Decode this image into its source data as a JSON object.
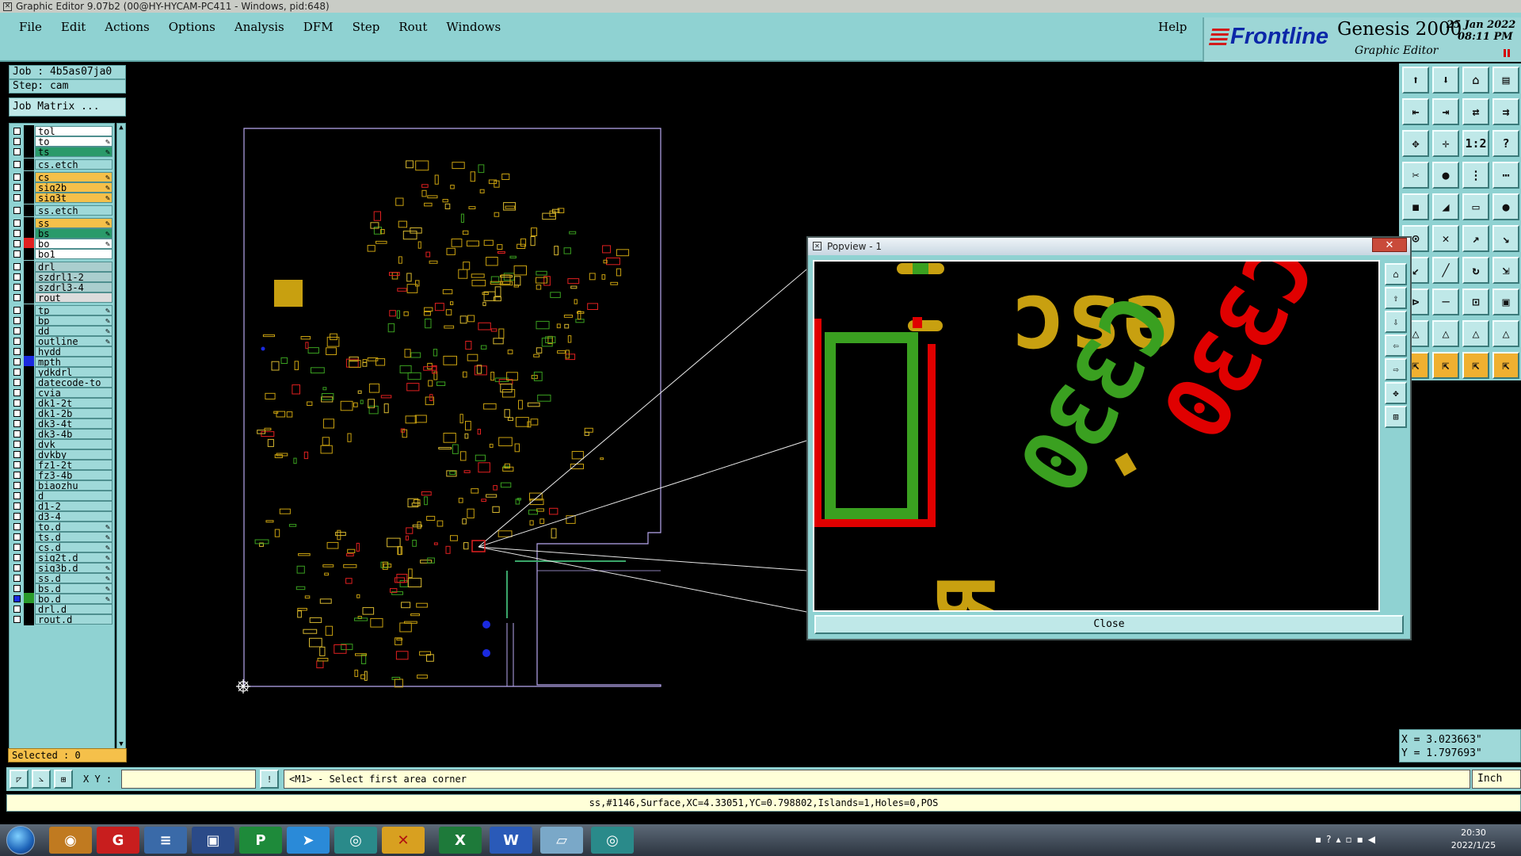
{
  "window": {
    "title": "Graphic Editor 9.07b2 (00@HY-HYCAM-PC411 - Windows, pid:648)"
  },
  "menu": {
    "items": [
      "File",
      "Edit",
      "Actions",
      "Options",
      "Analysis",
      "DFM",
      "Step",
      "Rout",
      "Windows"
    ],
    "help": "Help"
  },
  "brand": {
    "logo": "Frontline",
    "product": "Genesis 2000",
    "subtitle": "Graphic Editor",
    "date": "25 Jan 2022",
    "time": "08:11 PM"
  },
  "job": {
    "job": "Job : 4b5as07ja0",
    "step": "Step: cam",
    "matrix": "Job Matrix ..."
  },
  "layers": [
    {
      "name": "tol",
      "bg": "#ffffff"
    },
    {
      "name": "to",
      "bg": "#ffffff",
      "edit": true
    },
    {
      "name": "ts",
      "bg": "#2a9a6a",
      "edit": true
    },
    {
      "name": "cs.etch",
      "bg": "#9fd9d9",
      "gap": true
    },
    {
      "name": "cs",
      "bg": "#f5c04a",
      "edit": true,
      "gap": true
    },
    {
      "name": "sig2b",
      "bg": "#f5c04a",
      "edit": true
    },
    {
      "name": "sig3t",
      "bg": "#f5c04a",
      "edit": true
    },
    {
      "name": "ss.etch",
      "bg": "#9fd9d9",
      "gap": true
    },
    {
      "name": "ss",
      "bg": "#f5c04a",
      "edit": true,
      "gap": true
    },
    {
      "name": "bs",
      "bg": "#2a9a6a",
      "edit": true
    },
    {
      "name": "bo",
      "bg": "#ffffff",
      "edit": true,
      "color": "#e02020"
    },
    {
      "name": "bo1",
      "bg": "#ffffff"
    },
    {
      "name": "drl",
      "bg": "#aacece",
      "gap": true
    },
    {
      "name": "szdrl1-2",
      "bg": "#aacece"
    },
    {
      "name": "szdrl3-4",
      "bg": "#aacece"
    },
    {
      "name": "rout",
      "bg": "#dcdcdc"
    },
    {
      "name": "tp",
      "bg": "#9fd9d9",
      "edit": true,
      "gap": true
    },
    {
      "name": "bp",
      "bg": "#9fd9d9",
      "edit": true
    },
    {
      "name": "dd",
      "bg": "#9fd9d9",
      "edit": true
    },
    {
      "name": "outline",
      "bg": "#9fd9d9",
      "edit": true
    },
    {
      "name": "hydd",
      "bg": "#9fd9d9"
    },
    {
      "name": "mpth",
      "bg": "#9fd9d9",
      "color": "#1a2ae0"
    },
    {
      "name": "ydkdrl",
      "bg": "#9fd9d9"
    },
    {
      "name": "datecode-to",
      "bg": "#9fd9d9"
    },
    {
      "name": "cvia",
      "bg": "#9fd9d9"
    },
    {
      "name": "dk1-2t",
      "bg": "#9fd9d9"
    },
    {
      "name": "dk1-2b",
      "bg": "#9fd9d9"
    },
    {
      "name": "dk3-4t",
      "bg": "#9fd9d9"
    },
    {
      "name": "dk3-4b",
      "bg": "#9fd9d9"
    },
    {
      "name": "dvk",
      "bg": "#9fd9d9"
    },
    {
      "name": "dvkby",
      "bg": "#9fd9d9"
    },
    {
      "name": "fz1-2t",
      "bg": "#9fd9d9"
    },
    {
      "name": "fz3-4b",
      "bg": "#9fd9d9"
    },
    {
      "name": "biaozhu",
      "bg": "#9fd9d9"
    },
    {
      "name": "d",
      "bg": "#9fd9d9"
    },
    {
      "name": "d1-2",
      "bg": "#9fd9d9"
    },
    {
      "name": "d3-4",
      "bg": "#9fd9d9"
    },
    {
      "name": "to.d",
      "bg": "#9fd9d9",
      "edit": true
    },
    {
      "name": "ts.d",
      "bg": "#9fd9d9",
      "edit": true
    },
    {
      "name": "cs.d",
      "bg": "#9fd9d9",
      "edit": true
    },
    {
      "name": "sig2t.d",
      "bg": "#9fd9d9",
      "edit": true
    },
    {
      "name": "sig3b.d",
      "bg": "#9fd9d9",
      "edit": true
    },
    {
      "name": "ss.d",
      "bg": "#9fd9d9",
      "edit": true
    },
    {
      "name": "bs.d",
      "bg": "#9fd9d9",
      "edit": true
    },
    {
      "name": "bo.d",
      "bg": "#9fd9d9",
      "edit": true,
      "color": "#2a9a2a",
      "active": true
    },
    {
      "name": "drl.d",
      "bg": "#9fd9d9"
    },
    {
      "name": "rout.d",
      "bg": "#9fd9d9"
    }
  ],
  "selected": "Selected : 0",
  "popview": {
    "title": "Popview - 1",
    "close_label": "Close",
    "close_x": "✕"
  },
  "coords": {
    "x": "X = 3.023663\"",
    "y": "Y = 1.797693\""
  },
  "command": {
    "xy_label": "X Y :",
    "xy_value": "",
    "prompt": "<M1> - Select first area corner",
    "unit": "Inch"
  },
  "info": "ss,#1146,Surface,XC=4.33051,YC=0.798802,Islands=1,Holes=0,POS",
  "taskbar": {
    "time": "20:30",
    "date": "2022/1/25"
  }
}
